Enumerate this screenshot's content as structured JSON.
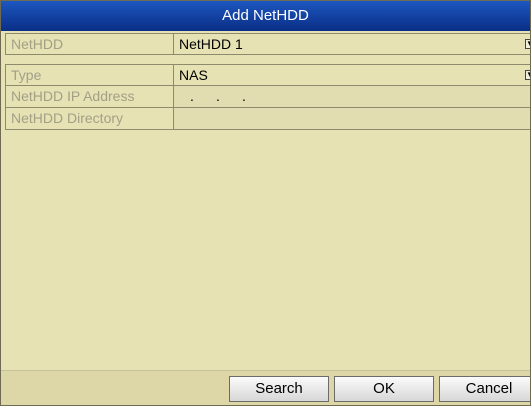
{
  "dialog": {
    "title": "Add NetHDD"
  },
  "form": {
    "nethdd": {
      "label": "NetHDD",
      "value": "NetHDD 1"
    },
    "type": {
      "label": "Type",
      "value": "NAS"
    },
    "ip_address": {
      "label": "NetHDD IP Address",
      "dots": [
        ".",
        ".",
        "."
      ]
    },
    "directory": {
      "label": "NetHDD Directory",
      "value": ""
    }
  },
  "buttons": {
    "search": "Search",
    "ok": "OK",
    "cancel": "Cancel"
  },
  "icons": {
    "dropdown": "chevron-down-icon"
  },
  "colors": {
    "title_bar": "#0a2e85",
    "panel_bg": "#e7e2b4",
    "label_text": "#a29f86"
  }
}
